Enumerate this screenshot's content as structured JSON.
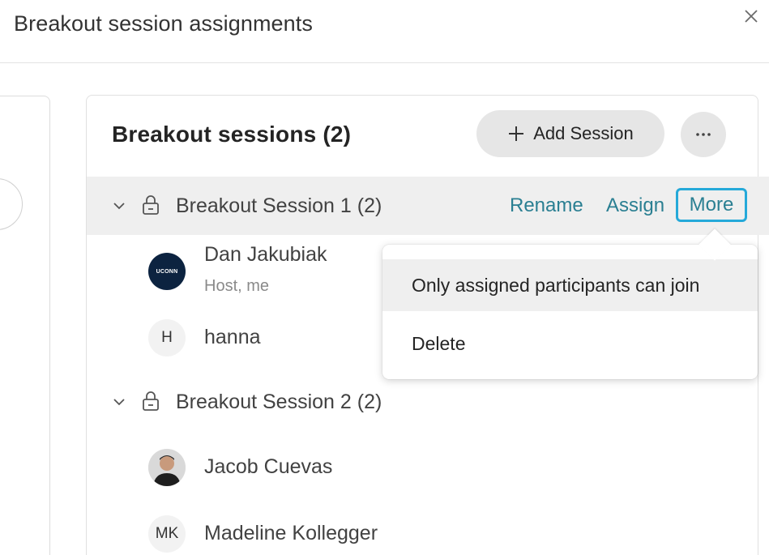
{
  "dialog": {
    "title": "Breakout session assignments",
    "close_icon": "close-icon"
  },
  "panel": {
    "title": "Breakout sessions  (2)",
    "add_session_label": "Add Session",
    "more_options_glyph": "···"
  },
  "sessions": [
    {
      "label": "Breakout Session 1 (2)",
      "actions": {
        "rename": "Rename",
        "assign": "Assign",
        "more": "More"
      },
      "participants": [
        {
          "name": "Dan Jakubiak",
          "subtitle": "Host, me",
          "avatar_text": "UCONN"
        },
        {
          "name": "hanna",
          "avatar_text": "H"
        }
      ]
    },
    {
      "label": "Breakout Session 2 (2)",
      "participants": [
        {
          "name": "Jacob Cuevas"
        },
        {
          "name": "Madeline Kollegger",
          "avatar_text": "MK"
        }
      ]
    }
  ],
  "more_menu": {
    "items": [
      "Only assigned participants can join",
      "Delete"
    ]
  },
  "colors": {
    "link": "#2a7f92",
    "focus_outline": "#25a9d9",
    "selected_row": "#efefef",
    "button_bg": "#e6e6e6"
  }
}
